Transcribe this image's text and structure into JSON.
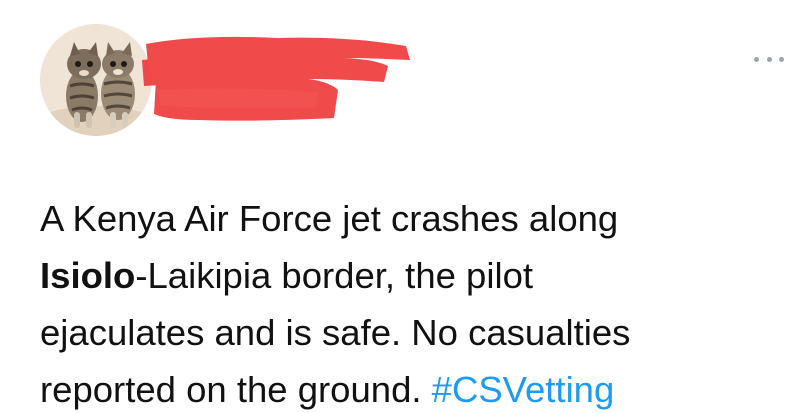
{
  "tweet": {
    "author_name_redacted": true,
    "menu_icon": "more-horizontal-icon",
    "text": {
      "line1": "A Kenya Air Force jet crashes along",
      "line2_bold": "Isiolo",
      "line2_rest": "-Laikipia border, the pilot",
      "line3": "ejaculates and is safe. No casualties",
      "line4_prefix": "reported on the ground. ",
      "hashtag": "#CSVetting"
    }
  },
  "colors": {
    "hashtag": "#1d9bf0",
    "redaction": "#ef3b3b",
    "text": "#111111",
    "menu_dots": "#9aa4ad"
  }
}
